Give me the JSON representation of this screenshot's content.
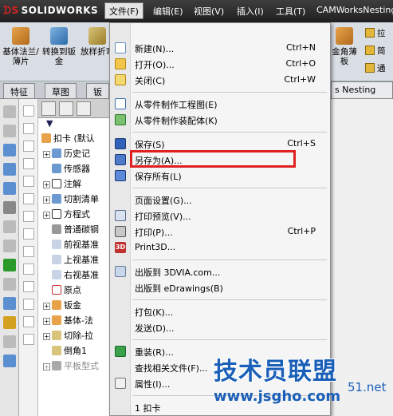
{
  "app": {
    "logo_text": "SOLIDWORKS"
  },
  "menubar": {
    "items": [
      "文件(F)",
      "编辑(E)",
      "视图(V)",
      "插入(I)",
      "工具(T)",
      "CAMWorksNesting"
    ],
    "active_index": 0
  },
  "ribbon": {
    "buttons": [
      "基体法兰/薄片",
      "转换到钣金",
      "放样折弯"
    ],
    "right_button": "金角薄板",
    "side_items": [
      "拉",
      "简",
      "通"
    ]
  },
  "tabs": {
    "left": [
      "特征",
      "草图",
      "钣"
    ],
    "right": "s Nesting"
  },
  "tree": {
    "filter_icon": "filter-icon",
    "nodes": [
      "扣卡 (默认",
      "历史记",
      "传感器",
      "注解",
      "切割清单",
      "方程式",
      "普通碳钢",
      "前视基准",
      "上视基准",
      "右视基准",
      "原点",
      "钣金",
      "基体-法",
      "切除-拉",
      "倒角1",
      "平板型式"
    ]
  },
  "file_menu": {
    "items": [
      {
        "label": "新建(N)...",
        "shortcut": "Ctrl+N",
        "icon": "new-file-icon"
      },
      {
        "label": "打开(O)...",
        "shortcut": "Ctrl+O",
        "icon": "open-folder-icon"
      },
      {
        "label": "关闭(C)",
        "shortcut": "Ctrl+W",
        "icon": "close-folder-icon"
      },
      {
        "label": "从零件制作工程图(E)",
        "shortcut": "",
        "icon": "make-drawing-icon"
      },
      {
        "label": "从零件制作装配体(K)",
        "shortcut": "",
        "icon": "make-assembly-icon"
      },
      {
        "label": "保存(S)",
        "shortcut": "Ctrl+S",
        "icon": "save-icon"
      },
      {
        "label": "另存为(A)...",
        "shortcut": "",
        "icon": "save-as-icon"
      },
      {
        "label": "保存所有(L)",
        "shortcut": "",
        "icon": "save-all-icon"
      },
      {
        "label": "页面设置(G)...",
        "shortcut": "",
        "icon": ""
      },
      {
        "label": "打印预览(V)...",
        "shortcut": "",
        "icon": "print-preview-icon"
      },
      {
        "label": "打印(P)...",
        "shortcut": "Ctrl+P",
        "icon": "print-icon"
      },
      {
        "label": "Print3D...",
        "shortcut": "",
        "icon": "print3d-icon"
      },
      {
        "label": "出版到 3DVIA.com...",
        "shortcut": "",
        "icon": "3dvia-icon"
      },
      {
        "label": "出版到 eDrawings(B)",
        "shortcut": "",
        "icon": ""
      },
      {
        "label": "打包(K)...",
        "shortcut": "",
        "icon": ""
      },
      {
        "label": "发送(D)...",
        "shortcut": "",
        "icon": ""
      },
      {
        "label": "重装(R)...",
        "shortcut": "",
        "icon": "reload-icon"
      },
      {
        "label": "查找相关文件(F)...",
        "shortcut": "",
        "icon": ""
      },
      {
        "label": "属性(I)...",
        "shortcut": "",
        "icon": "properties-icon"
      },
      {
        "label": "1 扣卡",
        "shortcut": "",
        "icon": ""
      }
    ],
    "highlighted_label": "另存为(A)...",
    "highlight_color": "#e02020"
  },
  "watermark": {
    "main": "技术员联盟",
    "url": "www.jsgho.com",
    "suffix": "51.net"
  }
}
